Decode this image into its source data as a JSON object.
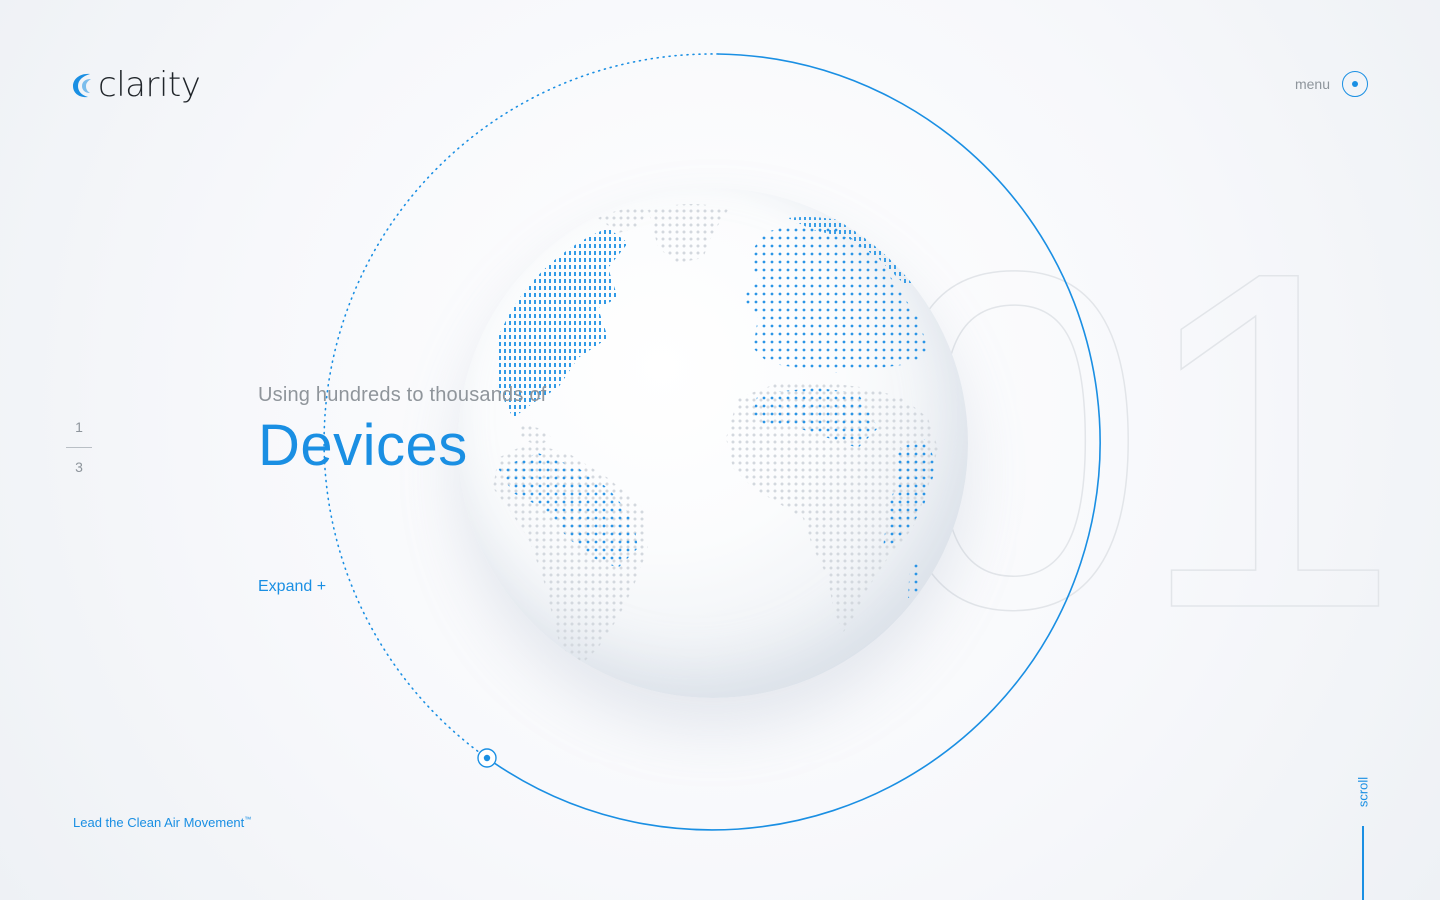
{
  "brand": {
    "name": "clarity",
    "logo_icon": "clarity-swirl-logo",
    "accent_color": "#1a8fe3"
  },
  "menu": {
    "label": "menu",
    "icon": "menu-dot-circle-icon"
  },
  "pagination": {
    "current": "1",
    "total": "3"
  },
  "hero": {
    "subtitle": "Using hundreds to thousands of",
    "title": "Devices",
    "expand_label": "Expand +",
    "background_number": "01",
    "globe": "dotted-world-globe"
  },
  "footer": {
    "tagline": "Lead the Clean Air Movement",
    "tagline_mark": "™"
  },
  "scroll": {
    "label": "scroll"
  }
}
